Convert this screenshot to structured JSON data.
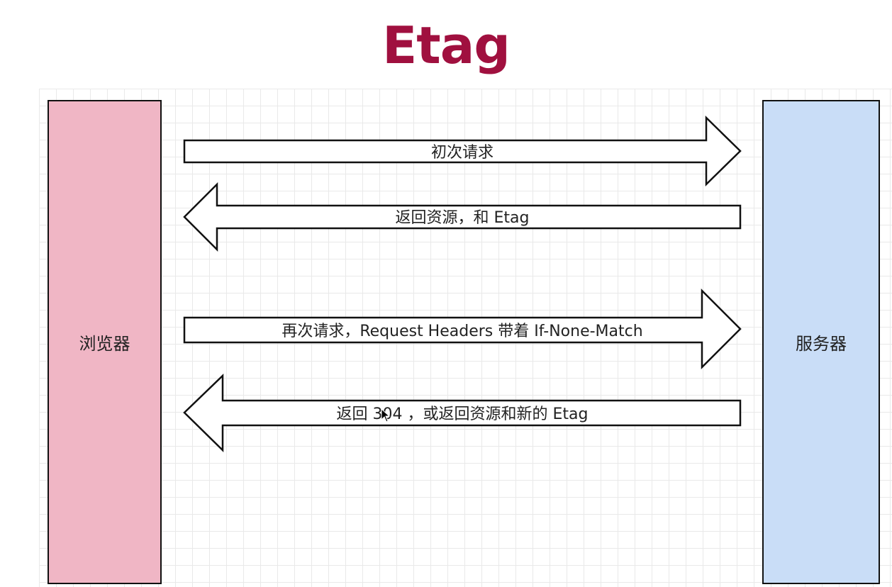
{
  "title": "Etag",
  "browser": {
    "label": "浏览器"
  },
  "server": {
    "label": "服务器"
  },
  "colors": {
    "title": "#a0103f",
    "browser_fill": "#f0b6c5",
    "server_fill": "#c9ddf7",
    "arrow_fill": "#ffffff",
    "stroke": "#111111"
  },
  "messages": [
    {
      "label": "初次请求",
      "direction": "to-server"
    },
    {
      "label": "返回资源，和 Etag",
      "direction": "to-browser"
    },
    {
      "label": "再次请求，Request Headers 带着 If-None-Match",
      "direction": "to-server"
    },
    {
      "label": "返回 304 ，或返回资源和新的 Etag",
      "direction": "to-browser"
    }
  ]
}
